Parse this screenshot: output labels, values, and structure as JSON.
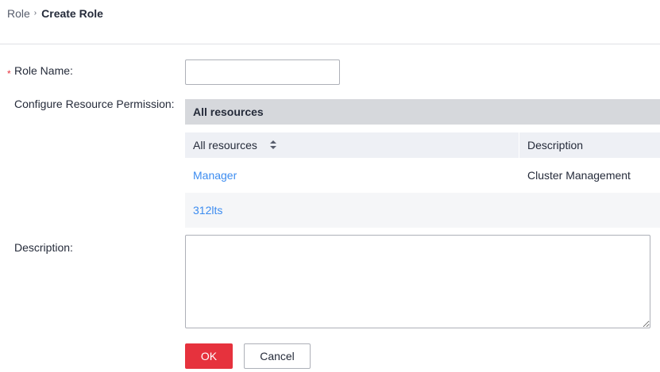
{
  "breadcrumb": {
    "parent": "Role",
    "separator": "›",
    "current": "Create Role"
  },
  "form": {
    "required_mark": "*",
    "role_name_label": "Role Name:",
    "role_name_value": "",
    "permission_label": "Configure Resource Permission:",
    "description_label": "Description:",
    "description_value": ""
  },
  "permissions": {
    "header": "All resources",
    "columns": [
      "All resources",
      "Description"
    ],
    "rows": [
      {
        "resource": "Manager",
        "description": "Cluster Management"
      },
      {
        "resource": "312lts",
        "description": ""
      }
    ]
  },
  "buttons": {
    "ok": "OK",
    "cancel": "Cancel"
  },
  "colors": {
    "primary": "#e6323d",
    "link": "#3c8cf0",
    "header_bg": "#d6d8dc",
    "table_head_bg": "#eef0f5"
  }
}
